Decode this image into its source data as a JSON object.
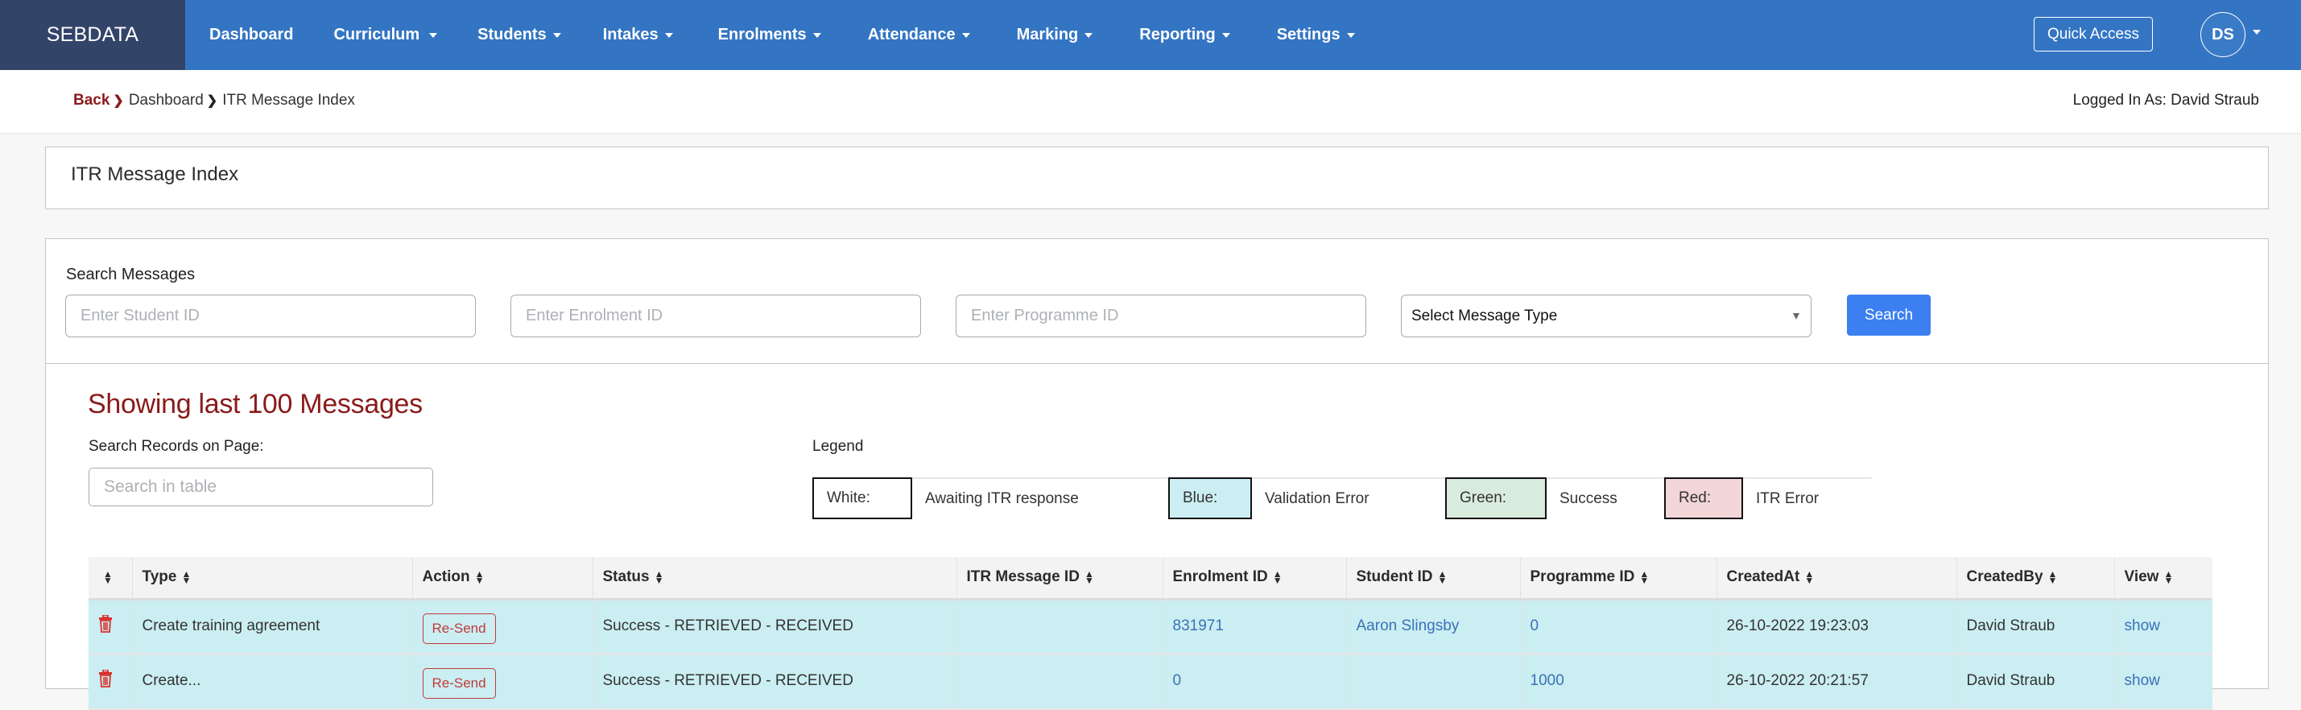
{
  "nav": {
    "brand": "SEBDATA",
    "items": [
      {
        "label": "Dashboard",
        "dropdown": false
      },
      {
        "label": "Curriculum",
        "dropdown": true
      },
      {
        "label": "Students",
        "dropdown": true
      },
      {
        "label": "Intakes",
        "dropdown": true
      },
      {
        "label": "Enrolments",
        "dropdown": true
      },
      {
        "label": "Attendance",
        "dropdown": true
      },
      {
        "label": "Marking",
        "dropdown": true
      },
      {
        "label": "Reporting",
        "dropdown": true
      },
      {
        "label": "Settings",
        "dropdown": true
      }
    ],
    "quick_access": "Quick Access",
    "avatar_initials": "DS"
  },
  "breadcrumb": {
    "back": "Back",
    "separator": "❯",
    "dashboard": "Dashboard",
    "current": "ITR Message Index"
  },
  "logged_in": "Logged In As: David Straub",
  "page_title": "ITR Message Index",
  "search": {
    "label": "Search Messages",
    "student_placeholder": "Enter Student ID",
    "enrolment_placeholder": "Enter Enrolment ID",
    "programme_placeholder": "Enter Programme ID",
    "message_type_selected": "Select Message Type",
    "button": "Search"
  },
  "results": {
    "heading": "Showing last 100 Messages",
    "records_label": "Search Records on Page:",
    "table_search_placeholder": "Search in table"
  },
  "legend": {
    "label": "Legend",
    "items": [
      {
        "swatch": "White:",
        "meaning": "Awaiting ITR response",
        "color": "#ffffff"
      },
      {
        "swatch": "Blue:",
        "meaning": "Validation Error",
        "color": "#cbeef2"
      },
      {
        "swatch": "Green:",
        "meaning": "Success",
        "color": "#d9ebdc"
      },
      {
        "swatch": "Red:",
        "meaning": "ITR Error",
        "color": "#f3d6d8"
      }
    ]
  },
  "table": {
    "columns": [
      "",
      "Type",
      "Action",
      "Status",
      "ITR Message ID",
      "Enrolment ID",
      "Student ID",
      "Programme ID",
      "CreatedAt",
      "CreatedBy",
      "View"
    ],
    "rows": [
      {
        "type": "Create training agreement",
        "action": "Re-Send",
        "status": "Success - RETRIEVED - RECEIVED",
        "itr_message_id": "",
        "enrolment_id": "831971",
        "student_id": "Aaron Slingsby",
        "programme_id": "0",
        "created_at": "26-10-2022 19:23:03",
        "created_by": "David Straub",
        "view": "show"
      },
      {
        "type": "Create...",
        "action": "Re-Send",
        "status": "Success - RETRIEVED - RECEIVED",
        "itr_message_id": "",
        "enrolment_id": "0",
        "student_id": "",
        "programme_id": "1000",
        "created_at": "26-10-2022 20:21:57",
        "created_by": "David Straub",
        "view": "show"
      }
    ]
  }
}
